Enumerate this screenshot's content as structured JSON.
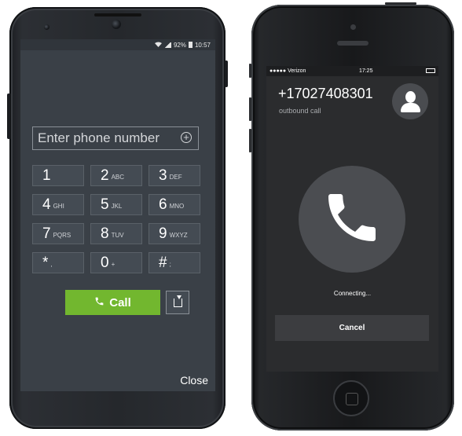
{
  "android": {
    "status": {
      "percent": "92%",
      "time": "10:57"
    },
    "input_placeholder": "Enter phone number",
    "add_symbol": "⊕",
    "keys": [
      {
        "digit": "1",
        "letters": ""
      },
      {
        "digit": "2",
        "letters": "ABC"
      },
      {
        "digit": "3",
        "letters": "DEF"
      },
      {
        "digit": "4",
        "letters": "GHI"
      },
      {
        "digit": "5",
        "letters": "JKL"
      },
      {
        "digit": "6",
        "letters": "MNO"
      },
      {
        "digit": "7",
        "letters": "PQRS"
      },
      {
        "digit": "8",
        "letters": "TUV"
      },
      {
        "digit": "9",
        "letters": "WXYZ"
      },
      {
        "digit": "*",
        "letters": ","
      },
      {
        "digit": "0",
        "letters": "+"
      },
      {
        "digit": "#",
        "letters": ";"
      }
    ],
    "call_label": "Call",
    "close_label": "Close"
  },
  "iphone": {
    "status": {
      "carrier": "●●●●● Verizon",
      "time": "17:25"
    },
    "number": "+17027408301",
    "subtitle": "outbound call",
    "connecting": "Connecting...",
    "cancel_label": "Cancel"
  },
  "colors": {
    "call_green": "#72b72f",
    "android_bg": "#3a4047",
    "ios_bg": "#2b2c2e"
  }
}
